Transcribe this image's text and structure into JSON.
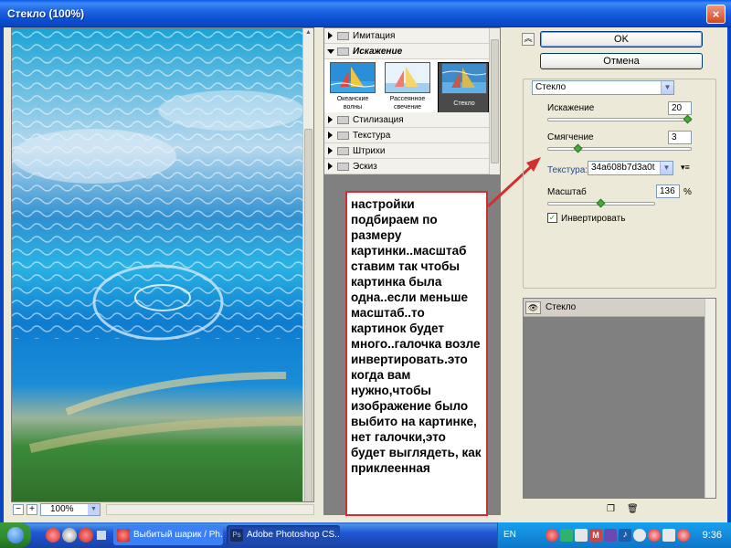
{
  "window": {
    "title": "Стекло (100%)",
    "close_icon": "×"
  },
  "preview": {
    "zoom_value": "100%",
    "zoom_minus": "−",
    "zoom_plus": "+"
  },
  "gallery": {
    "categories_top": [
      {
        "label": "Имитация",
        "open": false
      },
      {
        "label": "Искажение",
        "open": true
      }
    ],
    "thumbnails": [
      {
        "label": "Океанские волны",
        "selected": false
      },
      {
        "label": "Рассеянное свечение",
        "selected": false
      },
      {
        "label": "Стекло",
        "selected": true
      }
    ],
    "categories_bottom": [
      {
        "label": "Стилизация"
      },
      {
        "label": "Текстура"
      },
      {
        "label": "Штрихи"
      },
      {
        "label": "Эскиз"
      }
    ]
  },
  "annotation": {
    "text": "настройки подбираем по размеру картинки..масштаб ставим так чтобы картинка была одна..если меньше масштаб..то картинок будет много..галочка возле инвертировать.это когда вам нужно,чтобы изображение было выбито на картинке, нет галочки,это будет выглядеть, как приклеенная",
    "border_color": "#d23030"
  },
  "buttons": {
    "ok": "OK",
    "cancel": "Отмена",
    "collapse_icon": "chevron-up-icon"
  },
  "settings": {
    "filter_select": "Стекло",
    "distortion": {
      "label": "Искажение",
      "value": "20",
      "slider_fraction": 1.0
    },
    "smoothness": {
      "label": "Смягчение",
      "value": "3",
      "slider_fraction": 0.2
    },
    "texture": {
      "label": "Текстура:",
      "value": "34a608b7d3a0t"
    },
    "scale": {
      "label": "Масштаб",
      "value": "136",
      "unit": "%",
      "slider_fraction": 0.5
    },
    "invert": {
      "label": "Инвертировать",
      "checked": true
    }
  },
  "layers": {
    "items": [
      {
        "name": "Стекло"
      }
    ]
  },
  "taskbar": {
    "tasks": [
      {
        "label": "Выбитый шарик / Ph..."
      },
      {
        "label": "Adobe Photoshop CS..."
      }
    ],
    "language": "EN",
    "clock": "9:36"
  }
}
